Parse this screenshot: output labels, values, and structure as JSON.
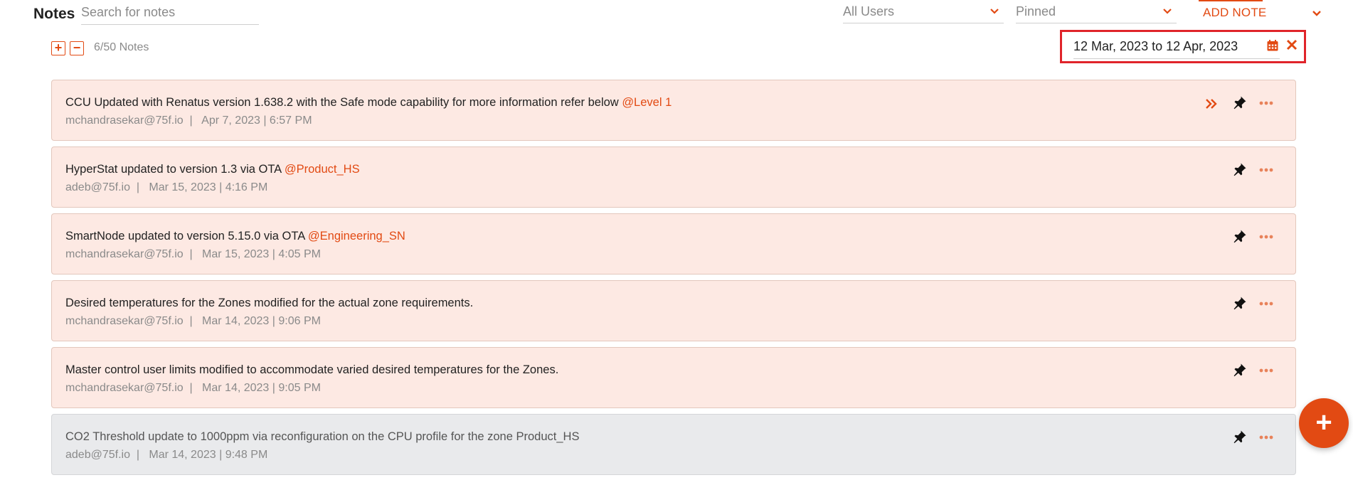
{
  "header": {
    "title": "Notes",
    "search_placeholder": "Search for notes",
    "users_filter": "All Users",
    "pinned_filter": "Pinned",
    "add_note_label": "ADD NOTE"
  },
  "toolbar": {
    "expand_label": "+",
    "collapse_label": "−",
    "count": "6/50 Notes"
  },
  "date_filter": {
    "value": "12 Mar, 2023 to 12 Apr, 2023"
  },
  "notes": [
    {
      "text": "CCU Updated with Renatus version 1.638.2 with the Safe mode capability for more information refer below ",
      "mention": "@Level 1",
      "meta": "mchandrasekar@75f.io  |   Apr 7, 2023 | 6:57 PM",
      "style": "highlight",
      "has_forward": true
    },
    {
      "text": "HyperStat updated to version 1.3 via OTA ",
      "mention": "@Product_HS",
      "meta": "adeb@75f.io  |   Mar 15, 2023 | 4:16 PM",
      "style": "highlight",
      "has_forward": false
    },
    {
      "text": "SmartNode updated to version 5.15.0  via OTA ",
      "mention": "@Engineering_SN",
      "meta": "mchandrasekar@75f.io  |   Mar 15, 2023 | 4:05 PM",
      "style": "highlight",
      "has_forward": false
    },
    {
      "text": "Desired temperatures for the Zones modified for the actual zone requirements.",
      "mention": "",
      "meta": "mchandrasekar@75f.io  |   Mar 14, 2023 | 9:06 PM",
      "style": "highlight",
      "has_forward": false
    },
    {
      "text": "Master control user limits modified to accommodate varied desired temperatures for the Zones.",
      "mention": "",
      "meta": "mchandrasekar@75f.io  |   Mar 14, 2023 | 9:05 PM",
      "style": "highlight",
      "has_forward": false
    },
    {
      "text": "CO2 Threshold update to 1000ppm via reconfiguration on the CPU profile for the zone Product_HS",
      "mention": "",
      "meta": "adeb@75f.io  |   Mar 14, 2023 | 9:48 PM",
      "style": "gray",
      "has_forward": false
    }
  ],
  "fab_label": "+",
  "colors": {
    "accent": "#e24a13",
    "note_bg": "#fde9e3",
    "note_gray_bg": "#e9eaec",
    "highlight_border": "#e0242a"
  }
}
